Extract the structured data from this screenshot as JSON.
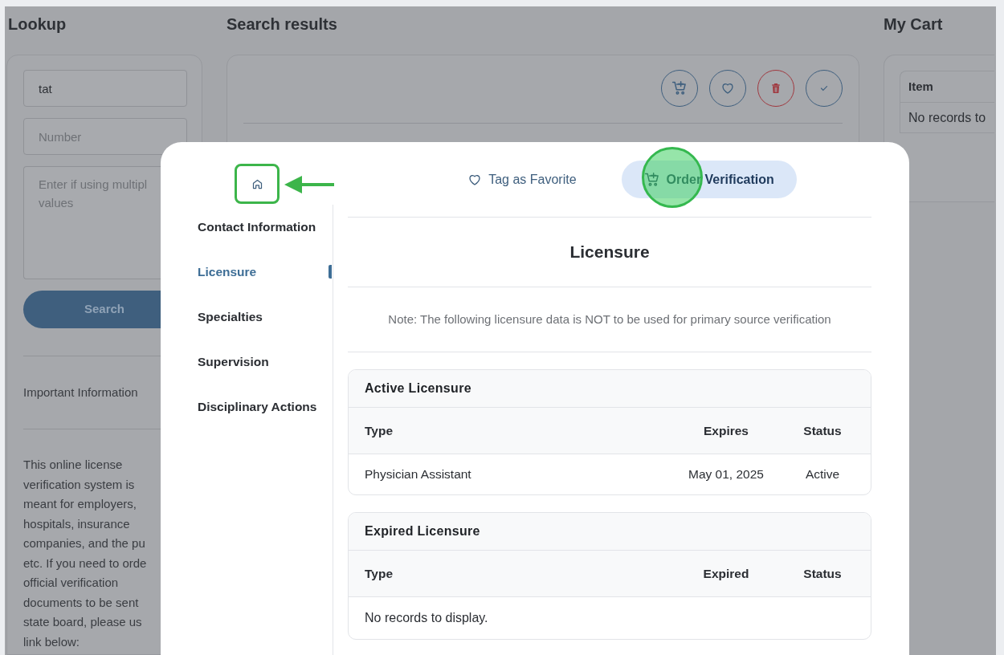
{
  "lookup": {
    "title": "Lookup",
    "name_field": {
      "value": "tat"
    },
    "number_field": {
      "placeholder": "Number"
    },
    "values_field": {
      "placeholder": "Enter if using multipl\nvalues"
    },
    "search_button": "Search",
    "important_heading": "Important Information",
    "notice": "This online license\nverification system is\nmeant for employers,\nhospitals, insurance\ncompanies, and the pu\netc. If you need to orde\nofficial verification\ndocuments to be sent\nstate board, please us\nlink below:"
  },
  "search_results": {
    "title": "Search results"
  },
  "cart": {
    "title": "My Cart",
    "columns": [
      "Item"
    ],
    "empty_message": "No records to"
  },
  "modal": {
    "nav": [
      {
        "label": "Contact Information",
        "selected": false
      },
      {
        "label": "Licensure",
        "selected": true
      },
      {
        "label": "Specialties",
        "selected": false
      },
      {
        "label": "Supervision",
        "selected": false
      },
      {
        "label": "Disciplinary Actions",
        "selected": false
      }
    ],
    "actions": [
      {
        "label": "Tag as Favorite",
        "kind": "favorite",
        "selected": false
      },
      {
        "label": "Order Verification",
        "kind": "order",
        "selected": true
      }
    ],
    "heading": "Licensure",
    "note": "Note: The following licensure data is NOT to be used for primary source verification",
    "sections": [
      {
        "title": "Active Licensure",
        "columns": [
          "Type",
          "Expires",
          "Status"
        ],
        "rows": [
          [
            "Physician Assistant",
            "May 01, 2025",
            "Active"
          ]
        ]
      },
      {
        "title": "Expired Licensure",
        "columns": [
          "Type",
          "Expired",
          "Status"
        ],
        "empty_message": "No records to display."
      }
    ]
  }
}
